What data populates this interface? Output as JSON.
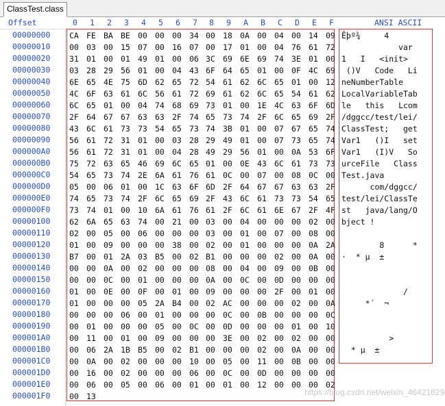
{
  "tab": {
    "title": "ClassTest.class"
  },
  "header": {
    "offset_label": "Offset",
    "hex_cols": [
      "0",
      "1",
      "2",
      "3",
      "4",
      "5",
      "6",
      "7",
      "8",
      "9",
      "A",
      "B",
      "C",
      "D",
      "E",
      "F"
    ],
    "ascii_label": "ANSI ASCII"
  },
  "rows": [
    {
      "offset": "00000000",
      "bytes": [
        "CA",
        "FE",
        "BA",
        "BE",
        "00",
        "00",
        "00",
        "34",
        "00",
        "18",
        "0A",
        "00",
        "04",
        "00",
        "14",
        "09"
      ],
      "ascii": "Êþº¾     4      "
    },
    {
      "offset": "00000010",
      "bytes": [
        "00",
        "03",
        "00",
        "15",
        "07",
        "00",
        "16",
        "07",
        "00",
        "17",
        "01",
        "00",
        "04",
        "76",
        "61",
        "72"
      ],
      "ascii": "            var"
    },
    {
      "offset": "00000020",
      "bytes": [
        "31",
        "01",
        "00",
        "01",
        "49",
        "01",
        "00",
        "06",
        "3C",
        "69",
        "6E",
        "69",
        "74",
        "3E",
        "01",
        "00"
      ],
      "ascii": "1   I   <init>"
    },
    {
      "offset": "00000030",
      "bytes": [
        "03",
        "28",
        "29",
        "56",
        "01",
        "00",
        "04",
        "43",
        "6F",
        "64",
        "65",
        "01",
        "00",
        "0F",
        "4C",
        "69"
      ],
      "ascii": " ()V   Code   Li"
    },
    {
      "offset": "00000040",
      "bytes": [
        "6E",
        "65",
        "4E",
        "75",
        "6D",
        "62",
        "65",
        "72",
        "54",
        "61",
        "62",
        "6C",
        "65",
        "01",
        "00",
        "12"
      ],
      "ascii": "neNumberTable"
    },
    {
      "offset": "00000050",
      "bytes": [
        "4C",
        "6F",
        "63",
        "61",
        "6C",
        "56",
        "61",
        "72",
        "69",
        "61",
        "62",
        "6C",
        "65",
        "54",
        "61",
        "62"
      ],
      "ascii": "LocalVariableTab"
    },
    {
      "offset": "00000060",
      "bytes": [
        "6C",
        "65",
        "01",
        "00",
        "04",
        "74",
        "68",
        "69",
        "73",
        "01",
        "00",
        "1E",
        "4C",
        "63",
        "6F",
        "6D"
      ],
      "ascii": "le   this   Lcom"
    },
    {
      "offset": "00000070",
      "bytes": [
        "2F",
        "64",
        "67",
        "67",
        "63",
        "63",
        "2F",
        "74",
        "65",
        "73",
        "74",
        "2F",
        "6C",
        "65",
        "69",
        "2F"
      ],
      "ascii": "/dggcc/test/lei/"
    },
    {
      "offset": "00000080",
      "bytes": [
        "43",
        "6C",
        "61",
        "73",
        "73",
        "54",
        "65",
        "73",
        "74",
        "3B",
        "01",
        "00",
        "07",
        "67",
        "65",
        "74"
      ],
      "ascii": "ClassTest;   get"
    },
    {
      "offset": "00000090",
      "bytes": [
        "56",
        "61",
        "72",
        "31",
        "01",
        "00",
        "03",
        "28",
        "29",
        "49",
        "01",
        "00",
        "07",
        "73",
        "65",
        "74"
      ],
      "ascii": "Var1   ()I   set"
    },
    {
      "offset": "000000A0",
      "bytes": [
        "56",
        "61",
        "72",
        "31",
        "01",
        "00",
        "04",
        "28",
        "49",
        "29",
        "56",
        "01",
        "00",
        "0A",
        "53",
        "6F"
      ],
      "ascii": "Var1   (I)V   So"
    },
    {
      "offset": "000000B0",
      "bytes": [
        "75",
        "72",
        "63",
        "65",
        "46",
        "69",
        "6C",
        "65",
        "01",
        "00",
        "0E",
        "43",
        "6C",
        "61",
        "73",
        "73"
      ],
      "ascii": "urceFile   Class"
    },
    {
      "offset": "000000C0",
      "bytes": [
        "54",
        "65",
        "73",
        "74",
        "2E",
        "6A",
        "61",
        "76",
        "61",
        "0C",
        "00",
        "07",
        "00",
        "08",
        "0C",
        "00"
      ],
      "ascii": "Test.java"
    },
    {
      "offset": "000000D0",
      "bytes": [
        "05",
        "00",
        "06",
        "01",
        "00",
        "1C",
        "63",
        "6F",
        "6D",
        "2F",
        "64",
        "67",
        "67",
        "63",
        "63",
        "2F"
      ],
      "ascii": "      com/dggcc/"
    },
    {
      "offset": "000000E0",
      "bytes": [
        "74",
        "65",
        "73",
        "74",
        "2F",
        "6C",
        "65",
        "69",
        "2F",
        "43",
        "6C",
        "61",
        "73",
        "73",
        "54",
        "65"
      ],
      "ascii": "test/lei/ClassTe"
    },
    {
      "offset": "000000F0",
      "bytes": [
        "73",
        "74",
        "01",
        "00",
        "10",
        "6A",
        "61",
        "76",
        "61",
        "2F",
        "6C",
        "61",
        "6E",
        "67",
        "2F",
        "4F"
      ],
      "ascii": "st   java/lang/O"
    },
    {
      "offset": "00000100",
      "bytes": [
        "62",
        "6A",
        "65",
        "63",
        "74",
        "00",
        "21",
        "00",
        "03",
        "00",
        "04",
        "00",
        "00",
        "00",
        "02",
        "00"
      ],
      "ascii": "bject !"
    },
    {
      "offset": "00000110",
      "bytes": [
        "02",
        "00",
        "05",
        "00",
        "06",
        "00",
        "00",
        "00",
        "03",
        "00",
        "01",
        "00",
        "07",
        "00",
        "08",
        "00"
      ],
      "ascii": ""
    },
    {
      "offset": "00000120",
      "bytes": [
        "01",
        "00",
        "09",
        "00",
        "00",
        "00",
        "38",
        "00",
        "02",
        "00",
        "01",
        "00",
        "00",
        "00",
        "0A",
        "2A"
      ],
      "ascii": "        8      *"
    },
    {
      "offset": "00000130",
      "bytes": [
        "B7",
        "00",
        "01",
        "2A",
        "03",
        "B5",
        "00",
        "02",
        "B1",
        "00",
        "00",
        "00",
        "02",
        "00",
        "0A",
        "00"
      ],
      "ascii": "·  * µ  ±"
    },
    {
      "offset": "00000140",
      "bytes": [
        "00",
        "00",
        "0A",
        "00",
        "02",
        "00",
        "00",
        "00",
        "08",
        "00",
        "04",
        "00",
        "09",
        "00",
        "0B",
        "00"
      ],
      "ascii": ""
    },
    {
      "offset": "00000150",
      "bytes": [
        "00",
        "00",
        "0C",
        "00",
        "01",
        "00",
        "00",
        "00",
        "0A",
        "00",
        "0C",
        "00",
        "0D",
        "00",
        "00",
        "00"
      ],
      "ascii": ""
    },
    {
      "offset": "00000160",
      "bytes": [
        "01",
        "00",
        "0E",
        "00",
        "0F",
        "00",
        "01",
        "00",
        "09",
        "00",
        "00",
        "00",
        "2F",
        "00",
        "01",
        "00"
      ],
      "ascii": "             /"
    },
    {
      "offset": "00000170",
      "bytes": [
        "01",
        "00",
        "00",
        "00",
        "05",
        "2A",
        "B4",
        "00",
        "02",
        "AC",
        "00",
        "00",
        "00",
        "02",
        "00",
        "0A"
      ],
      "ascii": "     *´  ¬"
    },
    {
      "offset": "00000180",
      "bytes": [
        "00",
        "00",
        "00",
        "06",
        "00",
        "01",
        "00",
        "00",
        "00",
        "0C",
        "00",
        "0B",
        "00",
        "00",
        "00",
        "0C"
      ],
      "ascii": ""
    },
    {
      "offset": "00000190",
      "bytes": [
        "00",
        "01",
        "00",
        "00",
        "00",
        "05",
        "00",
        "0C",
        "00",
        "0D",
        "00",
        "00",
        "00",
        "01",
        "00",
        "10"
      ],
      "ascii": ""
    },
    {
      "offset": "000001A0",
      "bytes": [
        "00",
        "11",
        "00",
        "01",
        "00",
        "09",
        "00",
        "00",
        "00",
        "3E",
        "00",
        "02",
        "00",
        "02",
        "00",
        "00"
      ],
      "ascii": "          >"
    },
    {
      "offset": "000001B0",
      "bytes": [
        "00",
        "06",
        "2A",
        "1B",
        "B5",
        "00",
        "02",
        "B1",
        "00",
        "00",
        "00",
        "02",
        "00",
        "0A",
        "00",
        "00"
      ],
      "ascii": "  * µ  ±"
    },
    {
      "offset": "000001C0",
      "bytes": [
        "00",
        "0A",
        "00",
        "02",
        "00",
        "00",
        "00",
        "10",
        "00",
        "05",
        "00",
        "11",
        "00",
        "0B",
        "00",
        "00"
      ],
      "ascii": ""
    },
    {
      "offset": "000001D0",
      "bytes": [
        "00",
        "16",
        "00",
        "02",
        "00",
        "00",
        "00",
        "06",
        "00",
        "0C",
        "00",
        "0D",
        "00",
        "00",
        "00",
        "00"
      ],
      "ascii": ""
    },
    {
      "offset": "000001E0",
      "bytes": [
        "00",
        "06",
        "00",
        "05",
        "00",
        "06",
        "00",
        "01",
        "00",
        "01",
        "00",
        "12",
        "00",
        "00",
        "00",
        "02"
      ],
      "ascii": ""
    },
    {
      "offset": "000001F0",
      "bytes": [
        "00",
        "13"
      ],
      "ascii": ""
    }
  ],
  "watermark": "https://blog.csdn.net/weixin_46421629"
}
